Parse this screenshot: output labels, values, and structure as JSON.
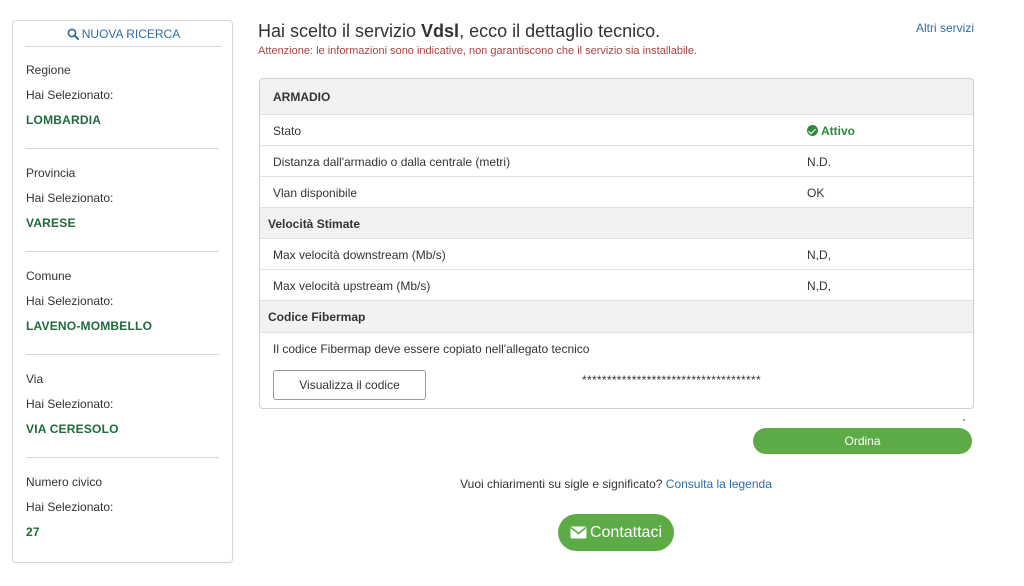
{
  "sidebar": {
    "new_search_label": "NUOVA RICERCA",
    "selected_prefix": "Hai Selezionato:",
    "sections": [
      {
        "label": "Regione",
        "value": "LOMBARDIA"
      },
      {
        "label": "Provincia",
        "value": "VARESE"
      },
      {
        "label": "Comune",
        "value": "LAVENO-MOMBELLO"
      },
      {
        "label": "Via",
        "value": "VIA CERESOLO"
      },
      {
        "label": "Numero civico",
        "value": "27"
      }
    ]
  },
  "header": {
    "title_prefix": "Hai scelto il servizio ",
    "service_name": "Vdsl",
    "title_suffix": ", ecco il dettaglio tecnico.",
    "warning": "Attenzione: le informazioni sono indicative, non garantiscono che il servizio sia installabile.",
    "other_services_link": "Altri servizi"
  },
  "details": {
    "armadio_header": "ARMADIO",
    "stato_label": "Stato",
    "stato_value": "Attivo",
    "distance_label": "Distanza dall'armadio o dalla centrale (metri)",
    "distance_value": "N.D.",
    "vlan_label": "Vlan disponibile",
    "vlan_value": "OK",
    "speed_header": "Velocità Stimate",
    "downstream_label": "Max velocità downstream (Mb/s)",
    "downstream_value": "N,D,",
    "upstream_label": "Max velocità upstream (Mb/s)",
    "upstream_value": "N,D,",
    "fibermap_header": "Codice Fibermap",
    "fibermap_note": "Il codice Fibermap deve essere copiato nell'allegato tecnico",
    "view_code_button": "Visualizza il codice",
    "masked_code": "************************************"
  },
  "actions": {
    "order_button": "Ordina",
    "legend_question": "Vuoi chiarimenti su sigle e significato?",
    "legend_link": "Consulta la legenda",
    "contact_button": "Contattaci"
  },
  "colors": {
    "accent_green": "#5cab47",
    "value_green": "#1f6b3a",
    "link_blue": "#2e6da4",
    "warning_red": "#a94442"
  },
  "icons": {
    "search": "search-icon",
    "status": "check-circle-icon",
    "contact": "envelope-icon"
  }
}
